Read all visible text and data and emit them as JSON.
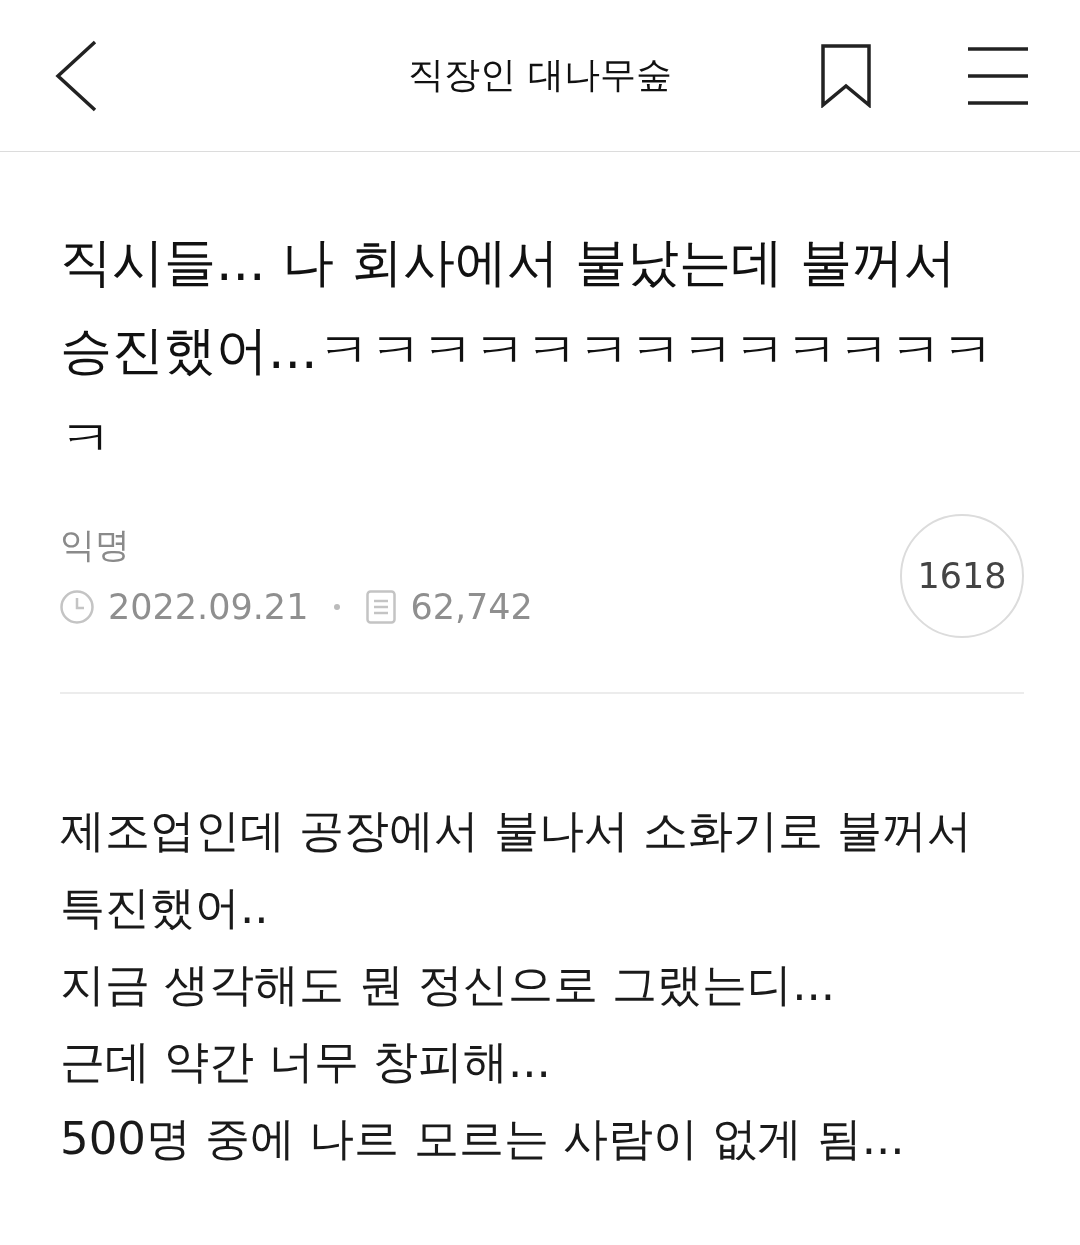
{
  "header": {
    "title": "직장인 대나무숲"
  },
  "post": {
    "title": "직시들... 나 회사에서 불났는데 불꺼서 승진했어...ㅋㅋㅋㅋㅋㅋㅋㅋㅋㅋㅋㅋㅋㅋ",
    "author": "익명",
    "date": "2022.09.21",
    "views": "62,742",
    "comment_count": "1618"
  },
  "body": {
    "paragraphs": [
      "제조업인데 공장에서 불나서 소화기로 불꺼서 특진했어..",
      "지금 생각해도 뭔 정신으로 그랬는디...",
      "근데 약간 너무 창피해...",
      "500명 중에 나르 모르는 사람이 없게 됨..."
    ]
  }
}
